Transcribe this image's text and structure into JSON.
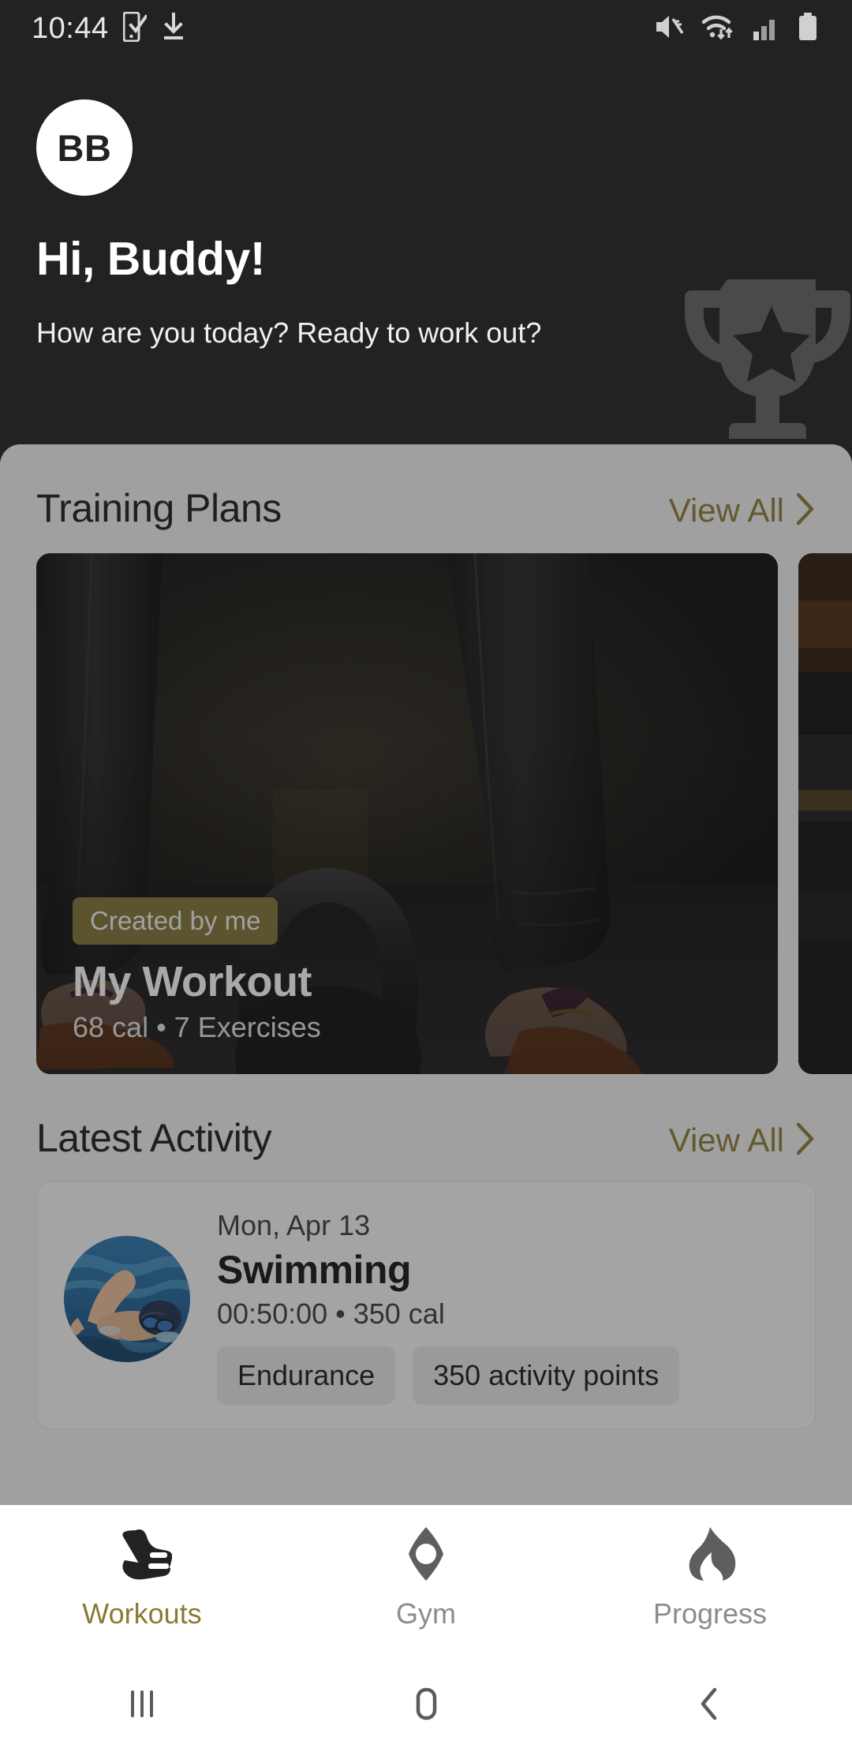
{
  "status_bar": {
    "time": "10:44",
    "left_icons": [
      "phone-check-icon",
      "download-icon"
    ],
    "right_icons": [
      "mute-icon",
      "wifi-icon",
      "signal-icon",
      "battery-icon"
    ]
  },
  "header": {
    "avatar_initials": "BB",
    "greeting": "Hi, Buddy!",
    "subtitle": "How are you today? Ready to work out?",
    "decoration_icon": "trophy-icon",
    "background_color": "#222222"
  },
  "training_plans": {
    "title": "Training Plans",
    "view_all_label": "View All",
    "cards": [
      {
        "badge": "Created by me",
        "title": "My Workout",
        "meta": "68 cal • 7 Exercises",
        "image": "kettlebell-photo"
      },
      {
        "badge": "",
        "title": "",
        "meta": "",
        "image": "gym-photo"
      }
    ]
  },
  "latest_activity": {
    "title": "Latest Activity",
    "view_all_label": "View All",
    "items": [
      {
        "date": "Mon, Apr 13",
        "name": "Swimming",
        "meta": "00:50:00 • 350 cal",
        "thumbnail": "swimmer-photo",
        "chips": [
          "Endurance",
          "350 activity points"
        ]
      }
    ]
  },
  "bottom_nav": {
    "items": [
      {
        "label": "Workouts",
        "icon": "shoe-icon",
        "active": true
      },
      {
        "label": "Gym",
        "icon": "dumbbell-icon",
        "active": false
      },
      {
        "label": "Progress",
        "icon": "flame-icon",
        "active": false
      }
    ],
    "active_color": "#8a7a33",
    "inactive_color": "#8c8c8c"
  },
  "android_nav": {
    "items": [
      "recents-icon",
      "home-icon",
      "back-icon"
    ]
  },
  "theme": {
    "accent": "#8a7a33",
    "badge_bg": "#7d7233",
    "dark_bg": "#222222",
    "sheet_bg": "#f1f1f1"
  }
}
